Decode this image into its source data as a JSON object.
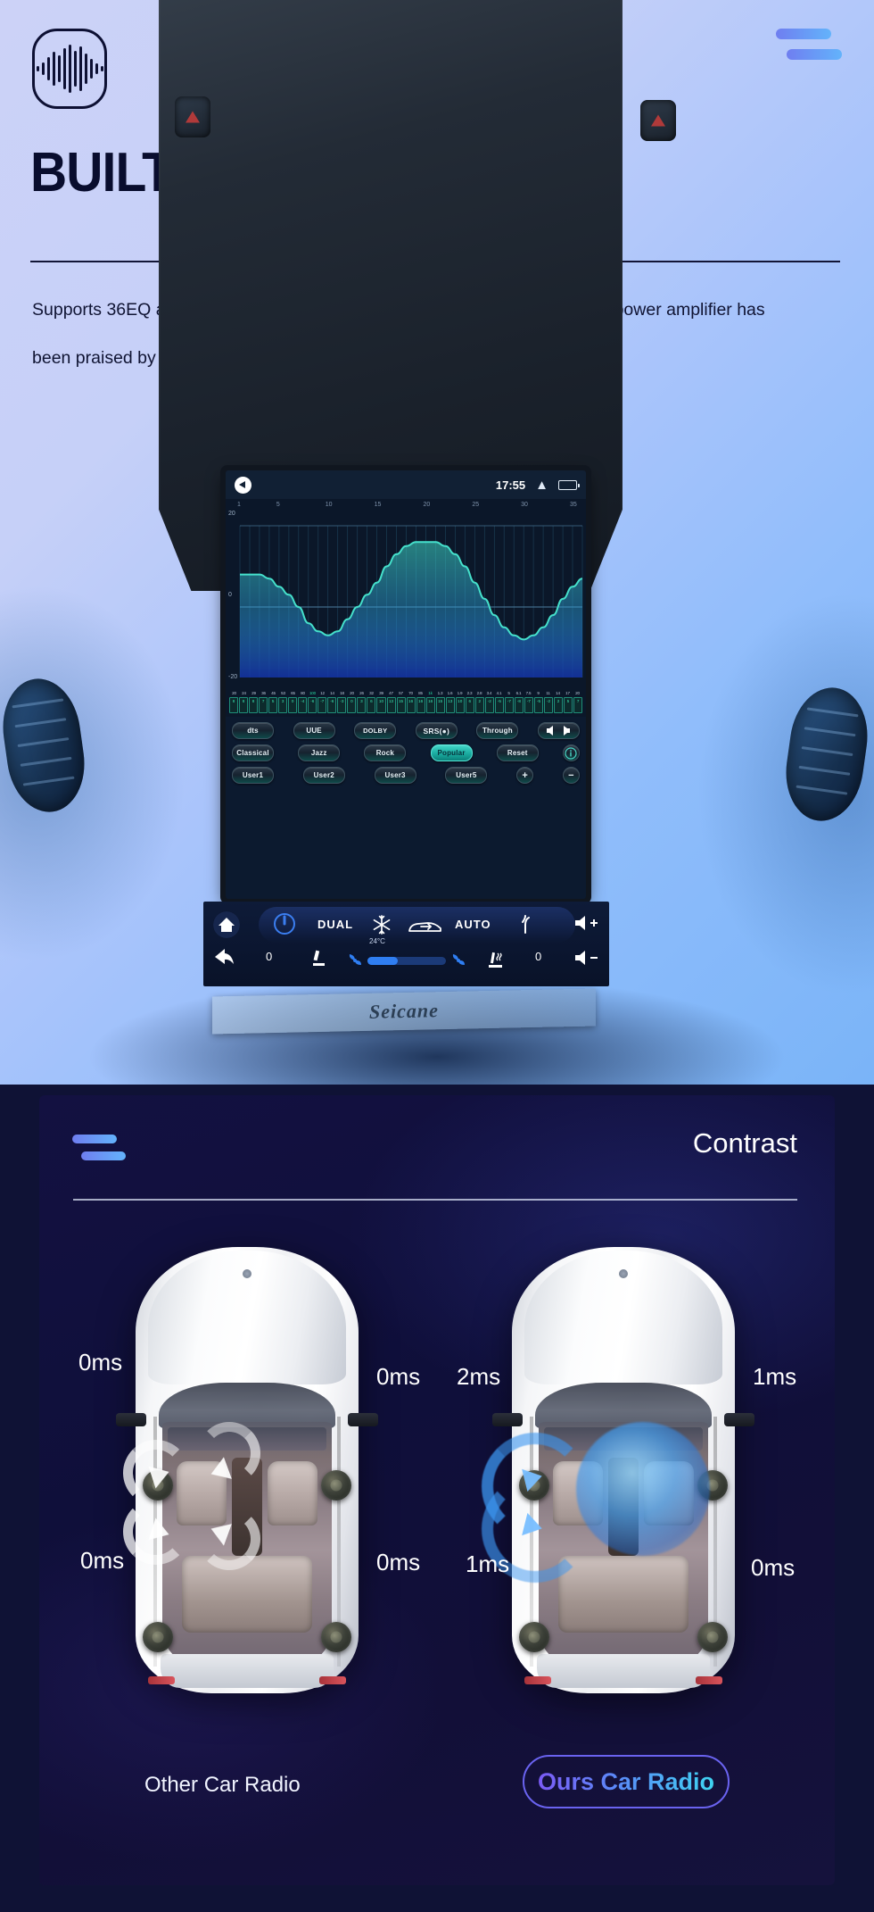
{
  "hero": {
    "logo_icon": "audio-waveform-icon",
    "menu_icon": "hamburger-icon",
    "title": "BUILT-IN DSP",
    "description": "Supports 36EQ adjustment, and the ultra-high sound quality brought by the power amplifier has been praised by the majority of buyers.",
    "brand_plate": "Seicane"
  },
  "head_unit": {
    "status_bar": {
      "mute_icon": "volume-mute-icon",
      "time": "17:55",
      "chevron_icon": "chevron-up-icon",
      "battery_icon": "battery-icon"
    },
    "eq": {
      "y_top": "20",
      "y_mid": "0",
      "y_bottom": "-20",
      "x_ticks": [
        "1",
        "5",
        "10",
        "15",
        "20",
        "25",
        "30",
        "35"
      ],
      "freq_labels": [
        "20",
        "24",
        "29",
        "36",
        "45",
        "53",
        "65",
        "80",
        "100",
        "12",
        "14",
        "18",
        "20",
        "26",
        "32",
        "39",
        "47",
        "57",
        "70",
        "85",
        "1k",
        "1.3",
        "1.6",
        "1.9",
        "2.3",
        "2.8",
        "3.4",
        "4.1",
        "5",
        "6.1",
        "7.5",
        "9",
        "11",
        "14",
        "17",
        "20"
      ],
      "highlight_indices": [
        8,
        20
      ],
      "band_values": [
        "8",
        "8",
        "8",
        "7",
        "5",
        "3",
        "0",
        "-4",
        "-6",
        "-7",
        "-6",
        "-3",
        "0",
        "3",
        "6",
        "10",
        "13",
        "15",
        "16",
        "16",
        "16",
        "15",
        "13",
        "10",
        "6",
        "2",
        "-2",
        "-5",
        "-7",
        "-8",
        "-7",
        "-5",
        "-2",
        "2",
        "5",
        "7"
      ]
    },
    "presets": {
      "row1": [
        {
          "label": "dts",
          "type": "logo",
          "active": false
        },
        {
          "label": "UUE",
          "type": "logo",
          "active": false
        },
        {
          "label": "DOLBY",
          "type": "logo",
          "active": false
        },
        {
          "label": "SRS(●)",
          "type": "logo",
          "active": false
        },
        {
          "label": "Through",
          "type": "text",
          "active": false
        },
        {
          "label": "balance-icon",
          "type": "icon",
          "active": false
        }
      ],
      "row2": [
        {
          "label": "Classical",
          "type": "text",
          "active": false
        },
        {
          "label": "Jazz",
          "type": "text",
          "active": false
        },
        {
          "label": "Rock",
          "type": "text",
          "active": false
        },
        {
          "label": "Popular",
          "type": "text",
          "active": true
        },
        {
          "label": "Reset",
          "type": "text",
          "active": false
        },
        {
          "label": "info-icon",
          "type": "icon",
          "active": false
        }
      ],
      "row3": [
        {
          "label": "User1",
          "type": "text",
          "active": false
        },
        {
          "label": "User2",
          "type": "text",
          "active": false
        },
        {
          "label": "User3",
          "type": "text",
          "active": false
        },
        {
          "label": "User5",
          "type": "text",
          "active": false
        },
        {
          "label": "+",
          "type": "round",
          "active": false
        },
        {
          "label": "−",
          "type": "round",
          "active": false
        }
      ]
    },
    "climate": {
      "home_icon": "home-icon",
      "power_icon": "power-icon",
      "dual_label": "DUAL",
      "ac_icon": "snowflake-icon",
      "temperature": "24°C",
      "recirc_icon": "air-recirculation-icon",
      "auto_label": "AUTO",
      "defrost_icon": "defrost-icon",
      "vol_up_icon": "volume-up-icon",
      "back_icon": "back-arrow-icon",
      "left_temp": "0",
      "seat_icon": "seat-position-icon",
      "fan_left_icon": "fan-icon",
      "fan_right_icon": "fan-icon",
      "heated_seat_icon": "heated-seat-icon",
      "right_temp": "0",
      "vol_down_icon": "volume-down-icon"
    }
  },
  "contrast": {
    "menu_icon": "hamburger-icon",
    "title": "Contrast",
    "left_car": {
      "caption": "Other Car Radio",
      "delays": {
        "front_left": "0ms",
        "front_right": "0ms",
        "rear_left": "0ms",
        "rear_right": "0ms"
      }
    },
    "right_car": {
      "caption": "Ours Car Radio",
      "delays": {
        "front_left": "2ms",
        "front_right": "1ms",
        "rear_left": "1ms",
        "rear_right": "0ms"
      }
    }
  },
  "colors": {
    "hero_gradient_start": "#ccd2f7",
    "hero_gradient_end": "#7ab4f8",
    "accent_blue": "#63b3fb",
    "accent_purple": "#6f7ef0",
    "accent_cyan": "#3fd4f2",
    "panel_bg": "#121041",
    "eq_curve": "#3fd9c4",
    "active_preset": "#18a79c"
  }
}
